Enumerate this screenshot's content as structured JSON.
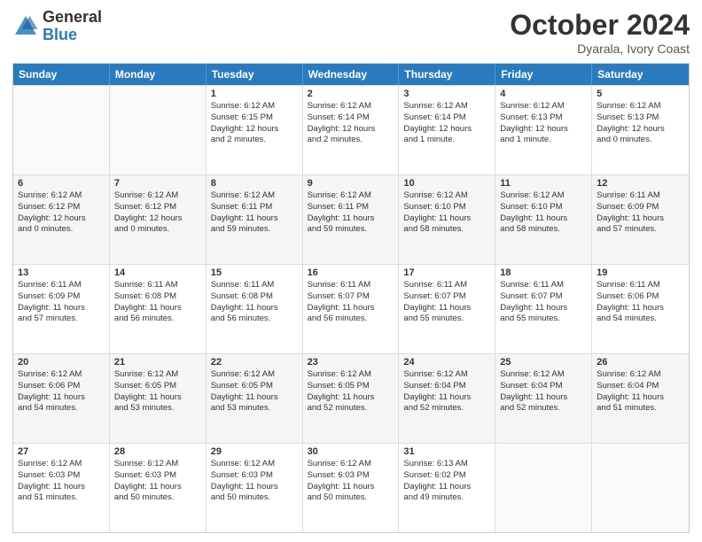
{
  "logo": {
    "general": "General",
    "blue": "Blue"
  },
  "header": {
    "month": "October 2024",
    "subtitle": "Dyarala, Ivory Coast"
  },
  "weekdays": [
    "Sunday",
    "Monday",
    "Tuesday",
    "Wednesday",
    "Thursday",
    "Friday",
    "Saturday"
  ],
  "rows": [
    [
      {
        "day": "",
        "empty": true,
        "lines": []
      },
      {
        "day": "",
        "empty": true,
        "lines": []
      },
      {
        "day": "1",
        "lines": [
          "Sunrise: 6:12 AM",
          "Sunset: 6:15 PM",
          "Daylight: 12 hours",
          "and 2 minutes."
        ]
      },
      {
        "day": "2",
        "lines": [
          "Sunrise: 6:12 AM",
          "Sunset: 6:14 PM",
          "Daylight: 12 hours",
          "and 2 minutes."
        ]
      },
      {
        "day": "3",
        "lines": [
          "Sunrise: 6:12 AM",
          "Sunset: 6:14 PM",
          "Daylight: 12 hours",
          "and 1 minute."
        ]
      },
      {
        "day": "4",
        "lines": [
          "Sunrise: 6:12 AM",
          "Sunset: 6:13 PM",
          "Daylight: 12 hours",
          "and 1 minute."
        ]
      },
      {
        "day": "5",
        "lines": [
          "Sunrise: 6:12 AM",
          "Sunset: 6:13 PM",
          "Daylight: 12 hours",
          "and 0 minutes."
        ]
      }
    ],
    [
      {
        "day": "6",
        "lines": [
          "Sunrise: 6:12 AM",
          "Sunset: 6:12 PM",
          "Daylight: 12 hours",
          "and 0 minutes."
        ]
      },
      {
        "day": "7",
        "lines": [
          "Sunrise: 6:12 AM",
          "Sunset: 6:12 PM",
          "Daylight: 12 hours",
          "and 0 minutes."
        ]
      },
      {
        "day": "8",
        "lines": [
          "Sunrise: 6:12 AM",
          "Sunset: 6:11 PM",
          "Daylight: 11 hours",
          "and 59 minutes."
        ]
      },
      {
        "day": "9",
        "lines": [
          "Sunrise: 6:12 AM",
          "Sunset: 6:11 PM",
          "Daylight: 11 hours",
          "and 59 minutes."
        ]
      },
      {
        "day": "10",
        "lines": [
          "Sunrise: 6:12 AM",
          "Sunset: 6:10 PM",
          "Daylight: 11 hours",
          "and 58 minutes."
        ]
      },
      {
        "day": "11",
        "lines": [
          "Sunrise: 6:12 AM",
          "Sunset: 6:10 PM",
          "Daylight: 11 hours",
          "and 58 minutes."
        ]
      },
      {
        "day": "12",
        "lines": [
          "Sunrise: 6:11 AM",
          "Sunset: 6:09 PM",
          "Daylight: 11 hours",
          "and 57 minutes."
        ]
      }
    ],
    [
      {
        "day": "13",
        "lines": [
          "Sunrise: 6:11 AM",
          "Sunset: 6:09 PM",
          "Daylight: 11 hours",
          "and 57 minutes."
        ]
      },
      {
        "day": "14",
        "lines": [
          "Sunrise: 6:11 AM",
          "Sunset: 6:08 PM",
          "Daylight: 11 hours",
          "and 56 minutes."
        ]
      },
      {
        "day": "15",
        "lines": [
          "Sunrise: 6:11 AM",
          "Sunset: 6:08 PM",
          "Daylight: 11 hours",
          "and 56 minutes."
        ]
      },
      {
        "day": "16",
        "lines": [
          "Sunrise: 6:11 AM",
          "Sunset: 6:07 PM",
          "Daylight: 11 hours",
          "and 56 minutes."
        ]
      },
      {
        "day": "17",
        "lines": [
          "Sunrise: 6:11 AM",
          "Sunset: 6:07 PM",
          "Daylight: 11 hours",
          "and 55 minutes."
        ]
      },
      {
        "day": "18",
        "lines": [
          "Sunrise: 6:11 AM",
          "Sunset: 6:07 PM",
          "Daylight: 11 hours",
          "and 55 minutes."
        ]
      },
      {
        "day": "19",
        "lines": [
          "Sunrise: 6:11 AM",
          "Sunset: 6:06 PM",
          "Daylight: 11 hours",
          "and 54 minutes."
        ]
      }
    ],
    [
      {
        "day": "20",
        "lines": [
          "Sunrise: 6:12 AM",
          "Sunset: 6:06 PM",
          "Daylight: 11 hours",
          "and 54 minutes."
        ]
      },
      {
        "day": "21",
        "lines": [
          "Sunrise: 6:12 AM",
          "Sunset: 6:05 PM",
          "Daylight: 11 hours",
          "and 53 minutes."
        ]
      },
      {
        "day": "22",
        "lines": [
          "Sunrise: 6:12 AM",
          "Sunset: 6:05 PM",
          "Daylight: 11 hours",
          "and 53 minutes."
        ]
      },
      {
        "day": "23",
        "lines": [
          "Sunrise: 6:12 AM",
          "Sunset: 6:05 PM",
          "Daylight: 11 hours",
          "and 52 minutes."
        ]
      },
      {
        "day": "24",
        "lines": [
          "Sunrise: 6:12 AM",
          "Sunset: 6:04 PM",
          "Daylight: 11 hours",
          "and 52 minutes."
        ]
      },
      {
        "day": "25",
        "lines": [
          "Sunrise: 6:12 AM",
          "Sunset: 6:04 PM",
          "Daylight: 11 hours",
          "and 52 minutes."
        ]
      },
      {
        "day": "26",
        "lines": [
          "Sunrise: 6:12 AM",
          "Sunset: 6:04 PM",
          "Daylight: 11 hours",
          "and 51 minutes."
        ]
      }
    ],
    [
      {
        "day": "27",
        "lines": [
          "Sunrise: 6:12 AM",
          "Sunset: 6:03 PM",
          "Daylight: 11 hours",
          "and 51 minutes."
        ]
      },
      {
        "day": "28",
        "lines": [
          "Sunrise: 6:12 AM",
          "Sunset: 6:03 PM",
          "Daylight: 11 hours",
          "and 50 minutes."
        ]
      },
      {
        "day": "29",
        "lines": [
          "Sunrise: 6:12 AM",
          "Sunset: 6:03 PM",
          "Daylight: 11 hours",
          "and 50 minutes."
        ]
      },
      {
        "day": "30",
        "lines": [
          "Sunrise: 6:12 AM",
          "Sunset: 6:03 PM",
          "Daylight: 11 hours",
          "and 50 minutes."
        ]
      },
      {
        "day": "31",
        "lines": [
          "Sunrise: 6:13 AM",
          "Sunset: 6:02 PM",
          "Daylight: 11 hours",
          "and 49 minutes."
        ]
      },
      {
        "day": "",
        "empty": true,
        "lines": []
      },
      {
        "day": "",
        "empty": true,
        "lines": []
      }
    ]
  ]
}
